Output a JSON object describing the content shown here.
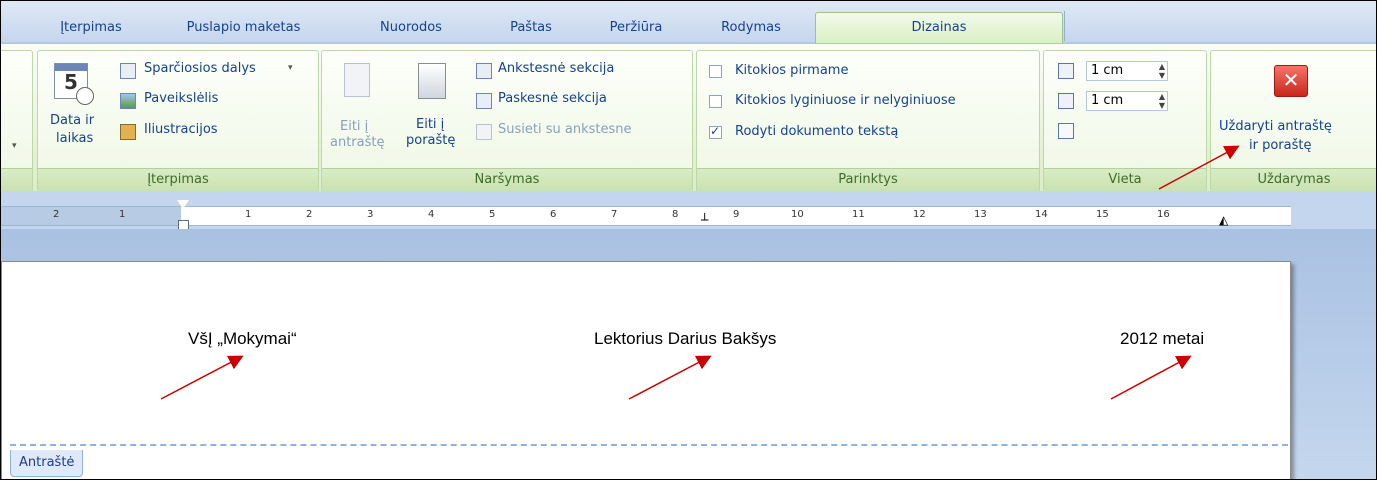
{
  "tabs": [
    "Įterpimas",
    "Puslapio maketas",
    "Nuorodos",
    "Paštas",
    "Peržiūra",
    "Rodymas",
    "Dizainas"
  ],
  "ribbon": {
    "iterpimas": {
      "data_ir_laikas": [
        "Data ir",
        "laikas"
      ],
      "calendar_number": "5",
      "sparciosios_dalys": "Sparčiosios dalys",
      "paveikslelis": "Paveikslėlis",
      "iliustracijos": "Iliustracijos",
      "label": "Įterpimas"
    },
    "narsymas": {
      "eiti_antraste": [
        "Eiti į",
        "antraštę"
      ],
      "eiti_poraste": [
        "Eiti į",
        "poraštę"
      ],
      "ankstesne": "Ankstesnė sekcija",
      "paskesne": "Paskesnė sekcija",
      "susieti": "Susieti su ankstesne",
      "label": "Naršymas"
    },
    "parinktys": {
      "kitokios_pirmame": "Kitokios pirmame",
      "kitokios_lyginiuose": "Kitokios lyginiuose ir nelyginiuose",
      "rodyti": "Rodyti dokumento tekstą",
      "label": "Parinktys"
    },
    "vieta": {
      "top_value": "1 cm",
      "bottom_value": "1 cm",
      "label": "Vieta"
    },
    "uzdarymas": {
      "button": [
        "Uždaryti antraštę",
        "ir poraštę"
      ],
      "label": "Uždarymas"
    }
  },
  "ruler": {
    "left_ticks": [
      "2",
      "1"
    ],
    "right_ticks": [
      "1",
      "2",
      "3",
      "4",
      "5",
      "6",
      "7",
      "8",
      "9",
      "10",
      "11",
      "12",
      "13",
      "14",
      "15",
      "16"
    ]
  },
  "document": {
    "header_left": "VšĮ „Mokymai“",
    "header_center": "Lektorius Darius Bakšys",
    "header_right": "2012 metai",
    "header_tag": "Antraštė"
  },
  "colors": {
    "arrow": "#cc0000",
    "active_tab": "#d9efc2",
    "close": "#d33a2e"
  }
}
